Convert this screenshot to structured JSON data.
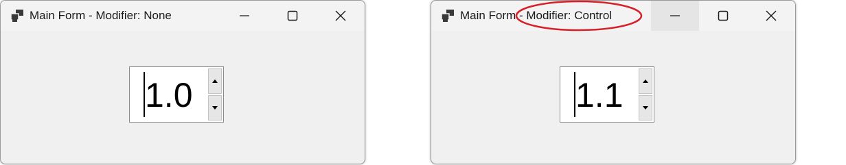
{
  "windows": [
    {
      "title": "Main Form - Modifier: None",
      "numeric_value": "1.0"
    },
    {
      "title": "Main Form - Modifier: Control",
      "numeric_value": "1.1"
    }
  ],
  "colors": {
    "window_bg": "#f0f0f0",
    "titlebar_bg": "#f3f3f3",
    "annotation": "#d6202b",
    "hovered_button": "#e5e5e5"
  },
  "icons": [
    "app-window-icon",
    "minimize-icon",
    "maximize-icon",
    "close-icon",
    "spin-up-arrow-icon",
    "spin-down-arrow-icon"
  ]
}
